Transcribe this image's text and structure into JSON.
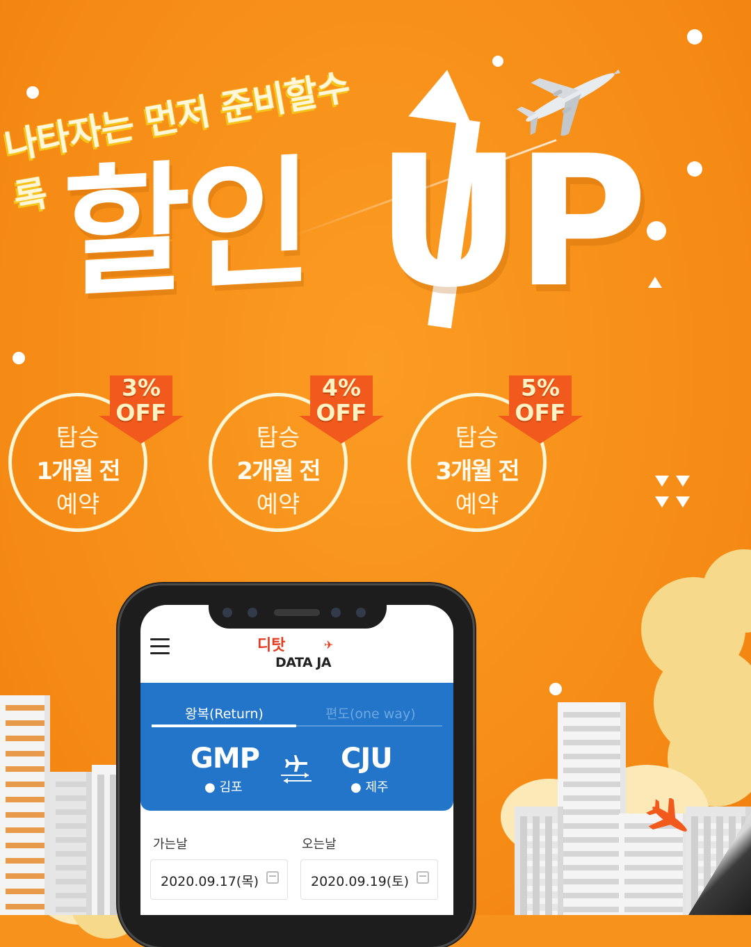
{
  "banner": {
    "tagline": "나타자는 먼저 준비할수록",
    "headline": "할인",
    "headline_up": "UP"
  },
  "offers": [
    {
      "line1": "탑승",
      "line2": "1개월 전",
      "line3": "예약",
      "pct": "3%",
      "off": "OFF"
    },
    {
      "line1": "탑승",
      "line2": "2개월 전",
      "line3": "예약",
      "pct": "4%",
      "off": "OFF"
    },
    {
      "line1": "탑승",
      "line2": "3개월 전",
      "line3": "예약",
      "pct": "5%",
      "off": "OFF"
    }
  ],
  "app": {
    "logo_mark": "디탓",
    "logo_word": "DATA JA",
    "tabs": {
      "return": "왕복(Return)",
      "oneway": "편도(one way)"
    },
    "route": {
      "from_code": "GMP",
      "from_city": "김포",
      "to_code": "CJU",
      "to_city": "제주"
    },
    "dates": {
      "depart_label": "가는날",
      "depart_value": "2020.09.17(목)",
      "return_label": "오는날",
      "return_value": "2020.09.19(토)"
    }
  },
  "colors": {
    "background": "#f7921c",
    "app_blue": "#2275c9",
    "badge_red": "#f25a1d",
    "logo_red": "#e53a1e"
  }
}
